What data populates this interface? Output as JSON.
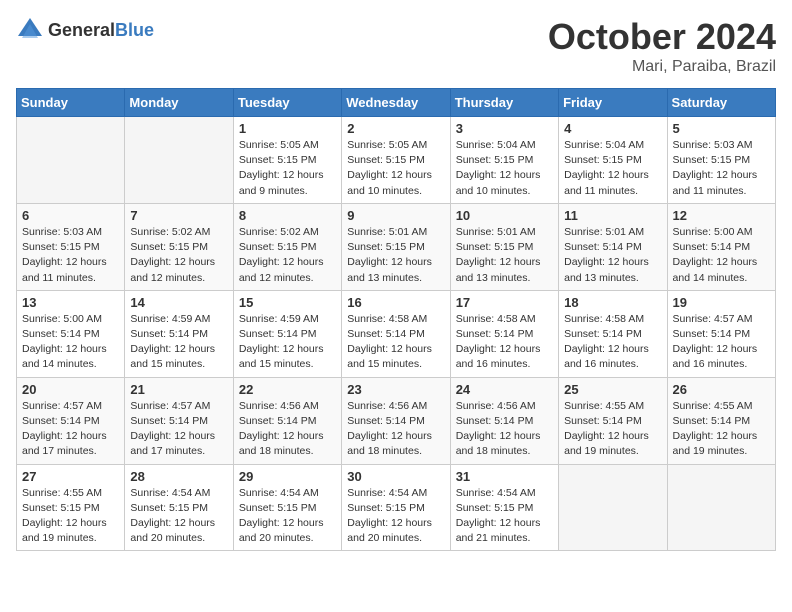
{
  "logo": {
    "general": "General",
    "blue": "Blue"
  },
  "header": {
    "month": "October 2024",
    "location": "Mari, Paraiba, Brazil"
  },
  "weekdays": [
    "Sunday",
    "Monday",
    "Tuesday",
    "Wednesday",
    "Thursday",
    "Friday",
    "Saturday"
  ],
  "weeks": [
    [
      {
        "day": "",
        "sunrise": "",
        "sunset": "",
        "daylight": ""
      },
      {
        "day": "",
        "sunrise": "",
        "sunset": "",
        "daylight": ""
      },
      {
        "day": "1",
        "sunrise": "Sunrise: 5:05 AM",
        "sunset": "Sunset: 5:15 PM",
        "daylight": "Daylight: 12 hours and 9 minutes."
      },
      {
        "day": "2",
        "sunrise": "Sunrise: 5:05 AM",
        "sunset": "Sunset: 5:15 PM",
        "daylight": "Daylight: 12 hours and 10 minutes."
      },
      {
        "day": "3",
        "sunrise": "Sunrise: 5:04 AM",
        "sunset": "Sunset: 5:15 PM",
        "daylight": "Daylight: 12 hours and 10 minutes."
      },
      {
        "day": "4",
        "sunrise": "Sunrise: 5:04 AM",
        "sunset": "Sunset: 5:15 PM",
        "daylight": "Daylight: 12 hours and 11 minutes."
      },
      {
        "day": "5",
        "sunrise": "Sunrise: 5:03 AM",
        "sunset": "Sunset: 5:15 PM",
        "daylight": "Daylight: 12 hours and 11 minutes."
      }
    ],
    [
      {
        "day": "6",
        "sunrise": "Sunrise: 5:03 AM",
        "sunset": "Sunset: 5:15 PM",
        "daylight": "Daylight: 12 hours and 11 minutes."
      },
      {
        "day": "7",
        "sunrise": "Sunrise: 5:02 AM",
        "sunset": "Sunset: 5:15 PM",
        "daylight": "Daylight: 12 hours and 12 minutes."
      },
      {
        "day": "8",
        "sunrise": "Sunrise: 5:02 AM",
        "sunset": "Sunset: 5:15 PM",
        "daylight": "Daylight: 12 hours and 12 minutes."
      },
      {
        "day": "9",
        "sunrise": "Sunrise: 5:01 AM",
        "sunset": "Sunset: 5:15 PM",
        "daylight": "Daylight: 12 hours and 13 minutes."
      },
      {
        "day": "10",
        "sunrise": "Sunrise: 5:01 AM",
        "sunset": "Sunset: 5:15 PM",
        "daylight": "Daylight: 12 hours and 13 minutes."
      },
      {
        "day": "11",
        "sunrise": "Sunrise: 5:01 AM",
        "sunset": "Sunset: 5:14 PM",
        "daylight": "Daylight: 12 hours and 13 minutes."
      },
      {
        "day": "12",
        "sunrise": "Sunrise: 5:00 AM",
        "sunset": "Sunset: 5:14 PM",
        "daylight": "Daylight: 12 hours and 14 minutes."
      }
    ],
    [
      {
        "day": "13",
        "sunrise": "Sunrise: 5:00 AM",
        "sunset": "Sunset: 5:14 PM",
        "daylight": "Daylight: 12 hours and 14 minutes."
      },
      {
        "day": "14",
        "sunrise": "Sunrise: 4:59 AM",
        "sunset": "Sunset: 5:14 PM",
        "daylight": "Daylight: 12 hours and 15 minutes."
      },
      {
        "day": "15",
        "sunrise": "Sunrise: 4:59 AM",
        "sunset": "Sunset: 5:14 PM",
        "daylight": "Daylight: 12 hours and 15 minutes."
      },
      {
        "day": "16",
        "sunrise": "Sunrise: 4:58 AM",
        "sunset": "Sunset: 5:14 PM",
        "daylight": "Daylight: 12 hours and 15 minutes."
      },
      {
        "day": "17",
        "sunrise": "Sunrise: 4:58 AM",
        "sunset": "Sunset: 5:14 PM",
        "daylight": "Daylight: 12 hours and 16 minutes."
      },
      {
        "day": "18",
        "sunrise": "Sunrise: 4:58 AM",
        "sunset": "Sunset: 5:14 PM",
        "daylight": "Daylight: 12 hours and 16 minutes."
      },
      {
        "day": "19",
        "sunrise": "Sunrise: 4:57 AM",
        "sunset": "Sunset: 5:14 PM",
        "daylight": "Daylight: 12 hours and 16 minutes."
      }
    ],
    [
      {
        "day": "20",
        "sunrise": "Sunrise: 4:57 AM",
        "sunset": "Sunset: 5:14 PM",
        "daylight": "Daylight: 12 hours and 17 minutes."
      },
      {
        "day": "21",
        "sunrise": "Sunrise: 4:57 AM",
        "sunset": "Sunset: 5:14 PM",
        "daylight": "Daylight: 12 hours and 17 minutes."
      },
      {
        "day": "22",
        "sunrise": "Sunrise: 4:56 AM",
        "sunset": "Sunset: 5:14 PM",
        "daylight": "Daylight: 12 hours and 18 minutes."
      },
      {
        "day": "23",
        "sunrise": "Sunrise: 4:56 AM",
        "sunset": "Sunset: 5:14 PM",
        "daylight": "Daylight: 12 hours and 18 minutes."
      },
      {
        "day": "24",
        "sunrise": "Sunrise: 4:56 AM",
        "sunset": "Sunset: 5:14 PM",
        "daylight": "Daylight: 12 hours and 18 minutes."
      },
      {
        "day": "25",
        "sunrise": "Sunrise: 4:55 AM",
        "sunset": "Sunset: 5:14 PM",
        "daylight": "Daylight: 12 hours and 19 minutes."
      },
      {
        "day": "26",
        "sunrise": "Sunrise: 4:55 AM",
        "sunset": "Sunset: 5:14 PM",
        "daylight": "Daylight: 12 hours and 19 minutes."
      }
    ],
    [
      {
        "day": "27",
        "sunrise": "Sunrise: 4:55 AM",
        "sunset": "Sunset: 5:15 PM",
        "daylight": "Daylight: 12 hours and 19 minutes."
      },
      {
        "day": "28",
        "sunrise": "Sunrise: 4:54 AM",
        "sunset": "Sunset: 5:15 PM",
        "daylight": "Daylight: 12 hours and 20 minutes."
      },
      {
        "day": "29",
        "sunrise": "Sunrise: 4:54 AM",
        "sunset": "Sunset: 5:15 PM",
        "daylight": "Daylight: 12 hours and 20 minutes."
      },
      {
        "day": "30",
        "sunrise": "Sunrise: 4:54 AM",
        "sunset": "Sunset: 5:15 PM",
        "daylight": "Daylight: 12 hours and 20 minutes."
      },
      {
        "day": "31",
        "sunrise": "Sunrise: 4:54 AM",
        "sunset": "Sunset: 5:15 PM",
        "daylight": "Daylight: 12 hours and 21 minutes."
      },
      {
        "day": "",
        "sunrise": "",
        "sunset": "",
        "daylight": ""
      },
      {
        "day": "",
        "sunrise": "",
        "sunset": "",
        "daylight": ""
      }
    ]
  ]
}
